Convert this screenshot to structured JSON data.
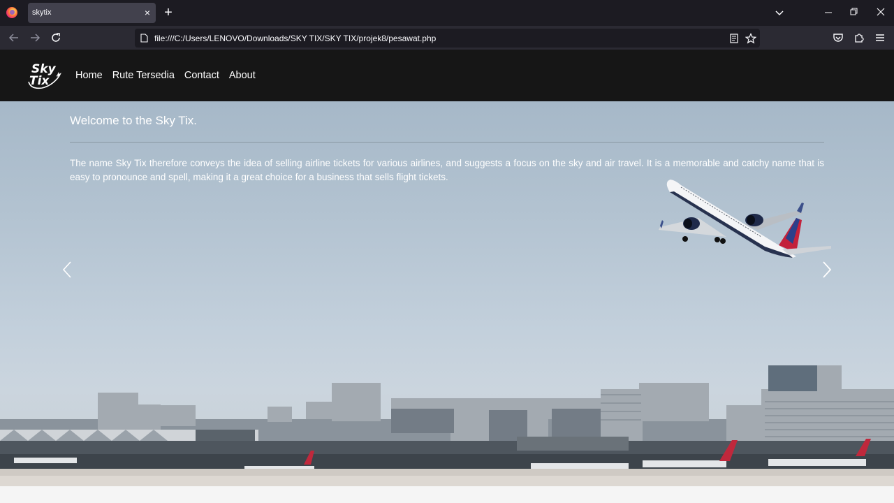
{
  "browser": {
    "tab_title": "skytix",
    "tab_close_symbol": "×",
    "new_tab_symbol": "+",
    "url": "file:///C:/Users/LENOVO/Downloads/SKY TIX/SKY TIX/projek8/pesawat.php",
    "icons": [
      "firefox-icon",
      "back-arrow-icon",
      "forward-arrow-icon",
      "reload-icon",
      "page-icon",
      "reader-view-icon",
      "bookmark-star-icon",
      "pocket-icon",
      "extensions-icon",
      "menu-icon",
      "tab-list-chevron-icon",
      "minimize-icon",
      "restore-icon",
      "close-icon"
    ]
  },
  "site": {
    "logo": "Sky Tix",
    "nav": [
      {
        "label": "Home"
      },
      {
        "label": "Rute Tersedia"
      },
      {
        "label": "Contact"
      },
      {
        "label": "About"
      }
    ]
  },
  "hero": {
    "title": "Welcome to the Sky Tix.",
    "description": "The name Sky Tix therefore conveys the idea of selling airline tickets for various airlines, and suggests a focus on the sky and air travel. It is a memorable and catchy name that is easy to pronounce and spell, making it a great choice for a business that sells flight tickets.",
    "prev_icon": "chevron-left-icon",
    "next_icon": "chevron-right-icon"
  },
  "colors": {
    "chrome_bg": "#1c1b22",
    "toolbar_bg": "#2b2a33",
    "site_header_bg": "#161616",
    "sky": "#b3c3d1"
  }
}
